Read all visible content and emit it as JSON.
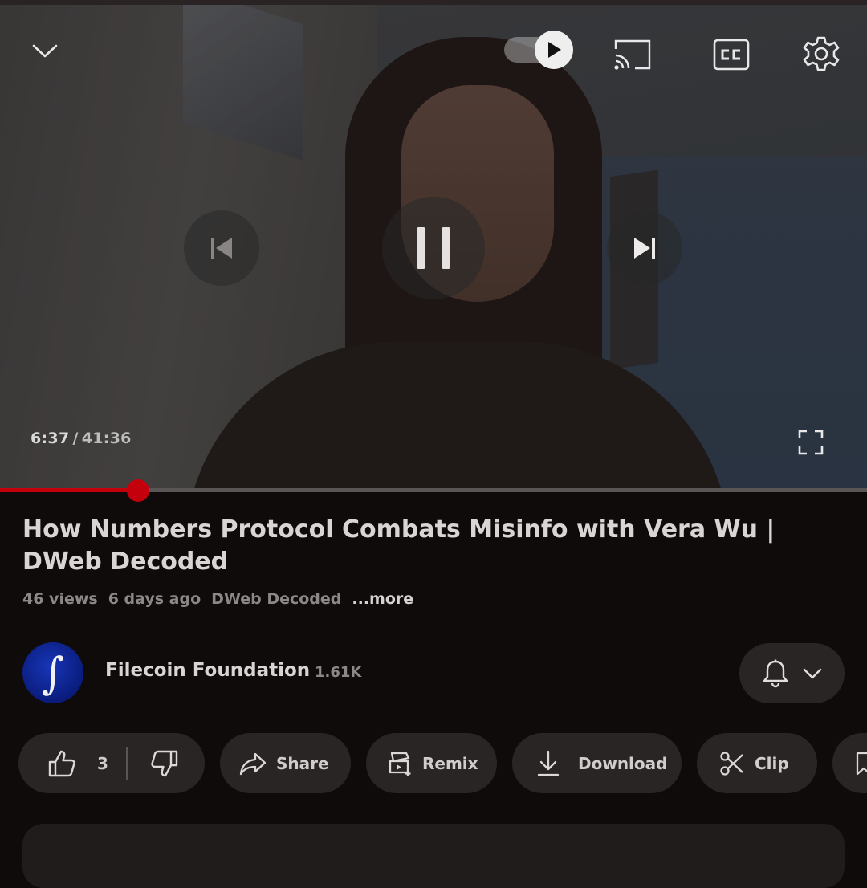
{
  "player": {
    "current_time": "6:37",
    "time_separator": "/",
    "duration": "41:36",
    "progress_fraction": 0.159
  },
  "video": {
    "title": "How Numbers Protocol Combats Misinfo with Vera Wu | DWeb Decoded",
    "views": "46 views",
    "age": "6 days ago",
    "playlist": "DWeb Decoded",
    "more_label": "...more"
  },
  "channel": {
    "name": "Filecoin Foundation",
    "subscribers": "1.61K",
    "avatar_glyph": "∫"
  },
  "actions": {
    "like_count": "3",
    "share_label": "Share",
    "remix_label": "Remix",
    "download_label": "Download",
    "clip_label": "Clip"
  },
  "colors": {
    "accent_red": "#c4000c",
    "background": "#0f0b0b",
    "pill_bg": "#2a2525"
  },
  "icons": [
    "chevron-down-icon",
    "autoplay-play-icon",
    "cast-icon",
    "captions-icon",
    "settings-gear-icon",
    "previous-icon",
    "pause-icon",
    "next-icon",
    "fullscreen-icon",
    "bell-icon",
    "chevron-down-icon",
    "thumbs-up-icon",
    "thumbs-down-icon",
    "share-arrow-icon",
    "remix-icon",
    "download-icon",
    "scissors-icon",
    "bookmark-icon"
  ]
}
